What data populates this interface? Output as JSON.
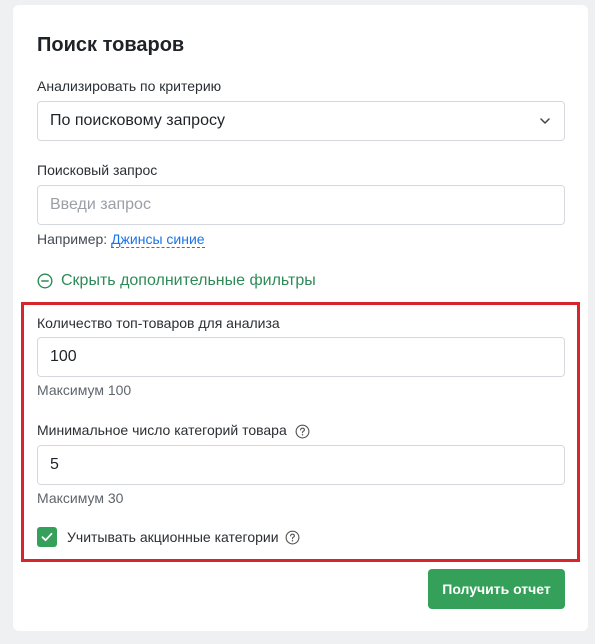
{
  "form": {
    "title": "Поиск товаров",
    "criteria_label": "Анализировать по критерию",
    "criteria_value": "По поисковому запросу",
    "query_label": "Поисковый запрос",
    "query_placeholder": "Введи запрос",
    "example_prefix": "Например:",
    "example_link": "Джинсы синие",
    "toggle_filters_label": "Скрыть дополнительные фильтры"
  },
  "filters": {
    "top_count_label": "Количество топ-товаров для анализа",
    "top_count_value": "100",
    "top_count_hint": "Максимум 100",
    "min_categories_label": "Минимальное число категорий товара",
    "min_categories_value": "5",
    "min_categories_hint": "Максимум 30",
    "promo_checkbox_label": "Учитывать акционные категории",
    "promo_checked": true
  },
  "actions": {
    "submit_label": "Получить отчет"
  },
  "colors": {
    "accent": "#34a05a",
    "link": "#1a73e8",
    "highlight_border": "#d6262b"
  }
}
